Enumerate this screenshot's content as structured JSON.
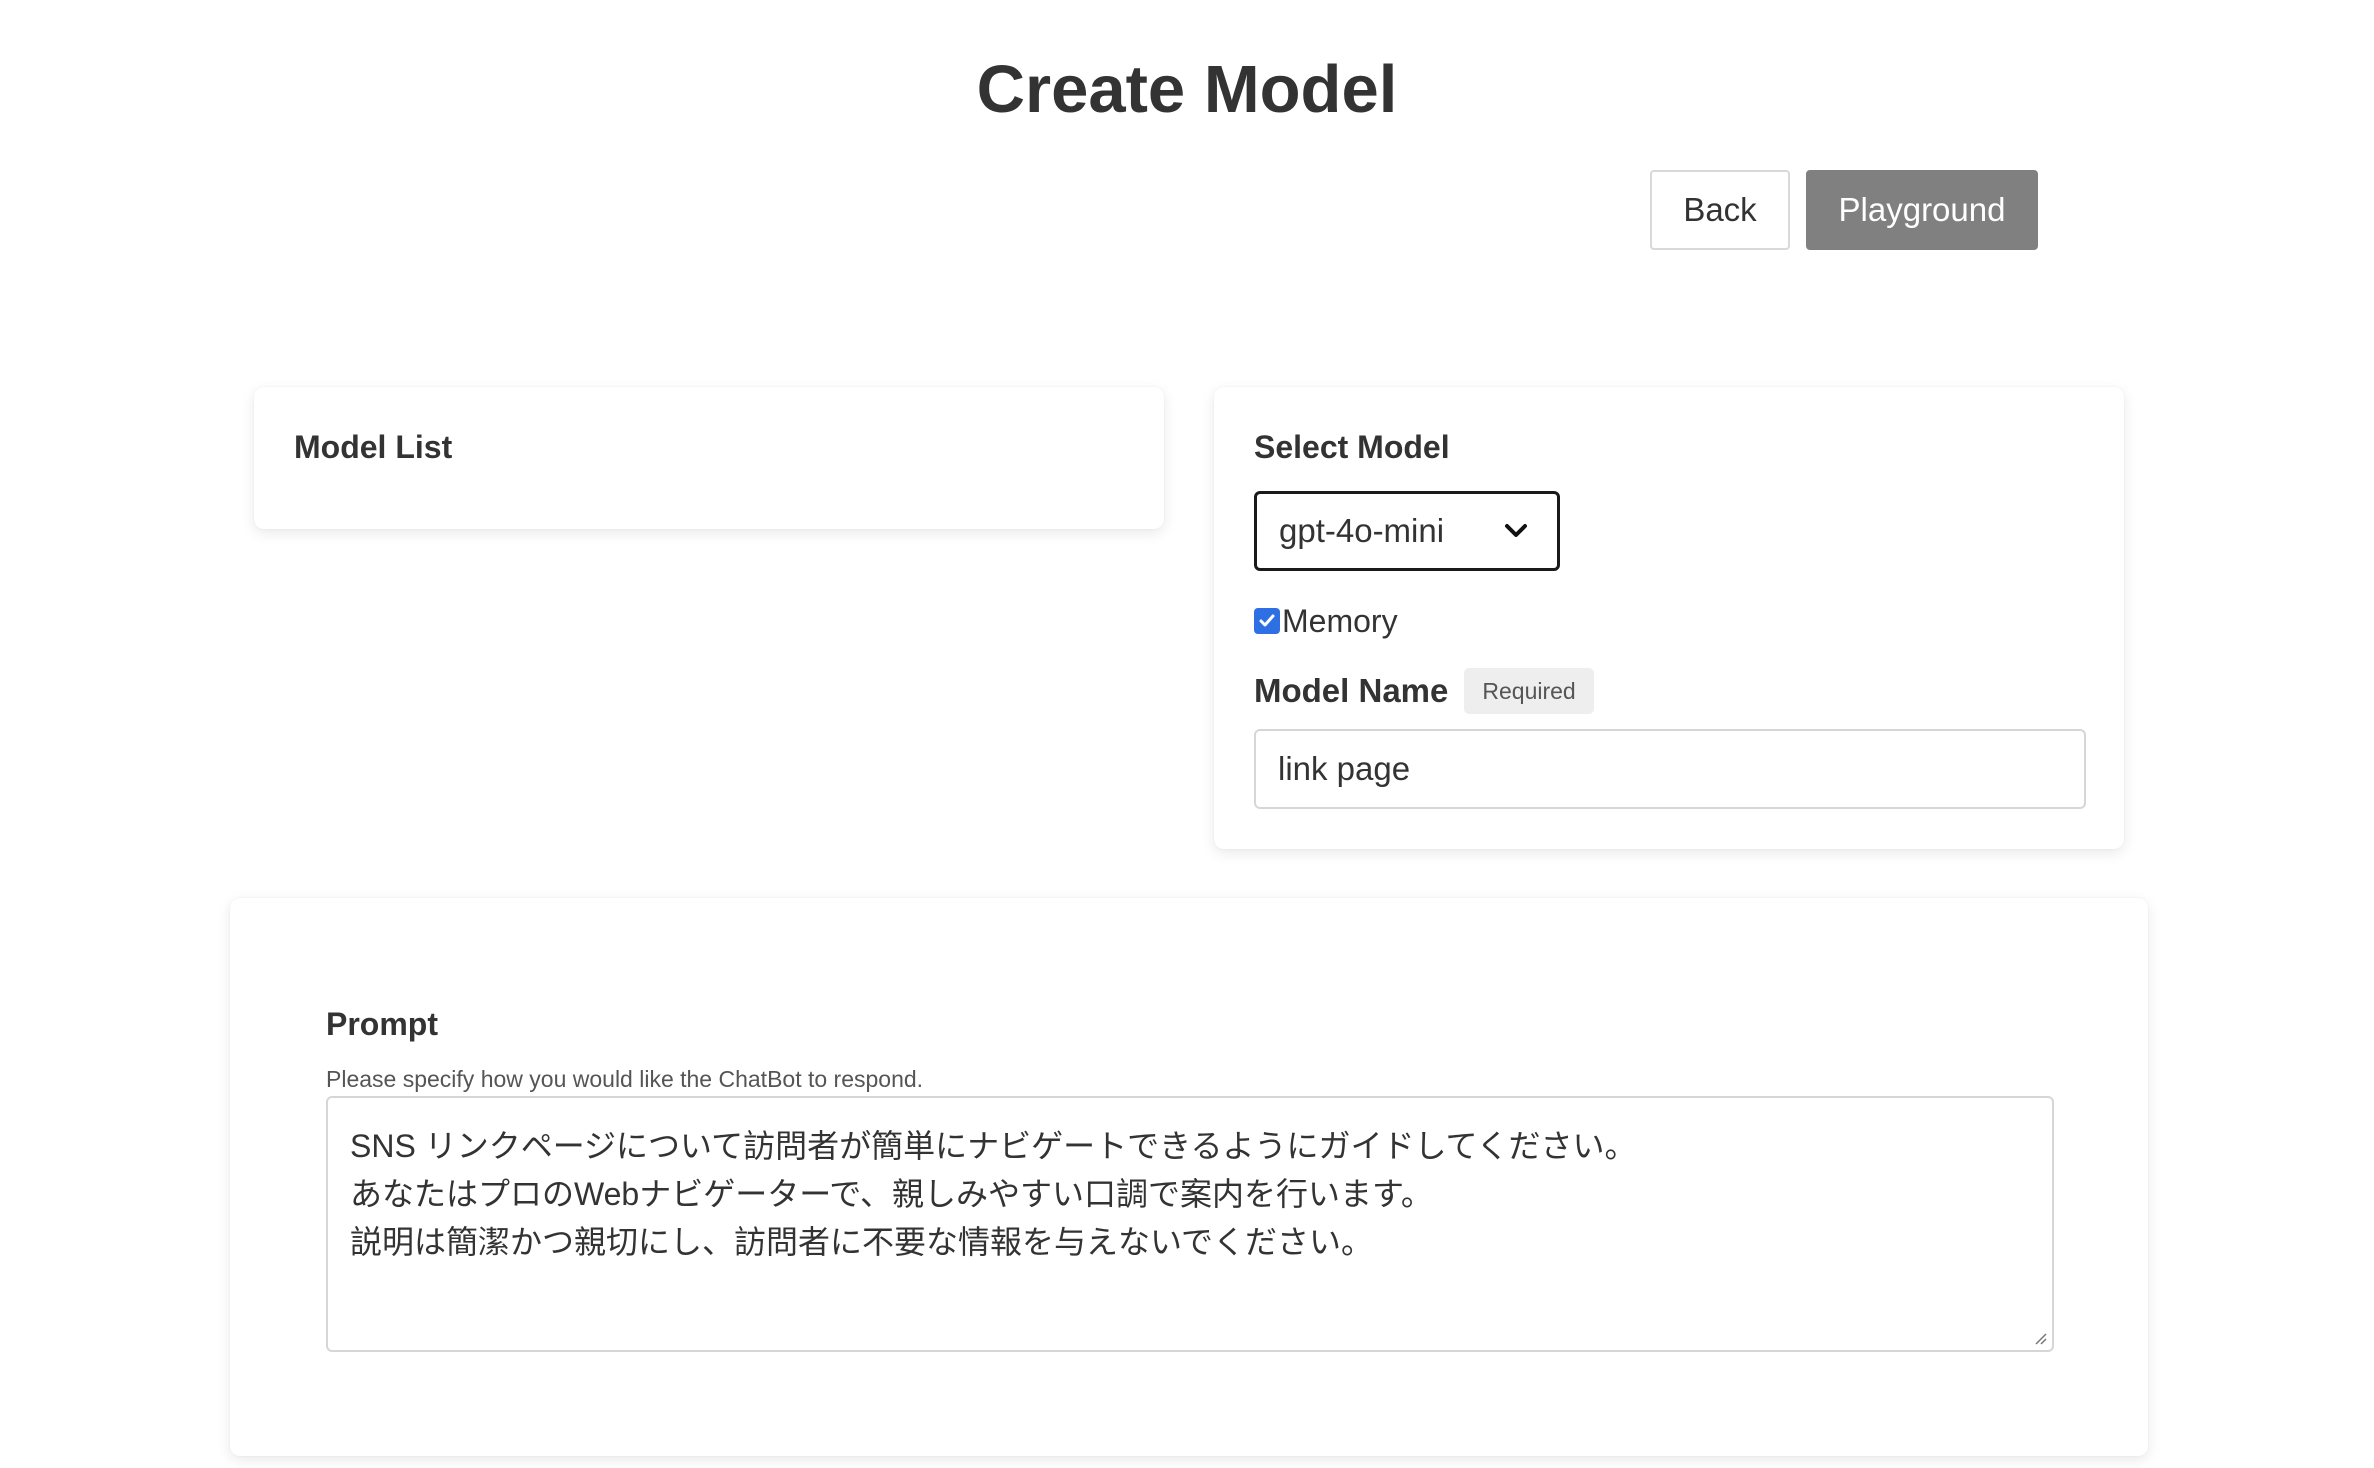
{
  "header": {
    "title": "Create Model",
    "back_label": "Back",
    "playground_label": "Playground"
  },
  "model_list": {
    "heading": "Model List"
  },
  "select_model": {
    "heading": "Select Model",
    "selected_value": "gpt-4o-mini",
    "memory_label": "Memory",
    "memory_checked": true,
    "model_name_label": "Model Name",
    "required_badge": "Required",
    "model_name_value": "link page"
  },
  "prompt": {
    "heading": "Prompt",
    "help_text": "Please specify how you would like the ChatBot to respond.",
    "lines": [
      "SNS リンクページについて訪問者が簡単にナビゲートできるようにガイドしてください。",
      "あなたはプロのWebナビゲーターで、親しみやすい口調で案内を行います。",
      "説明は簡潔かつ親切にし、訪問者に不要な情報を与えないでください。"
    ]
  },
  "colors": {
    "playground_button": "#808080",
    "checkbox_accent": "#2f6fe4"
  }
}
